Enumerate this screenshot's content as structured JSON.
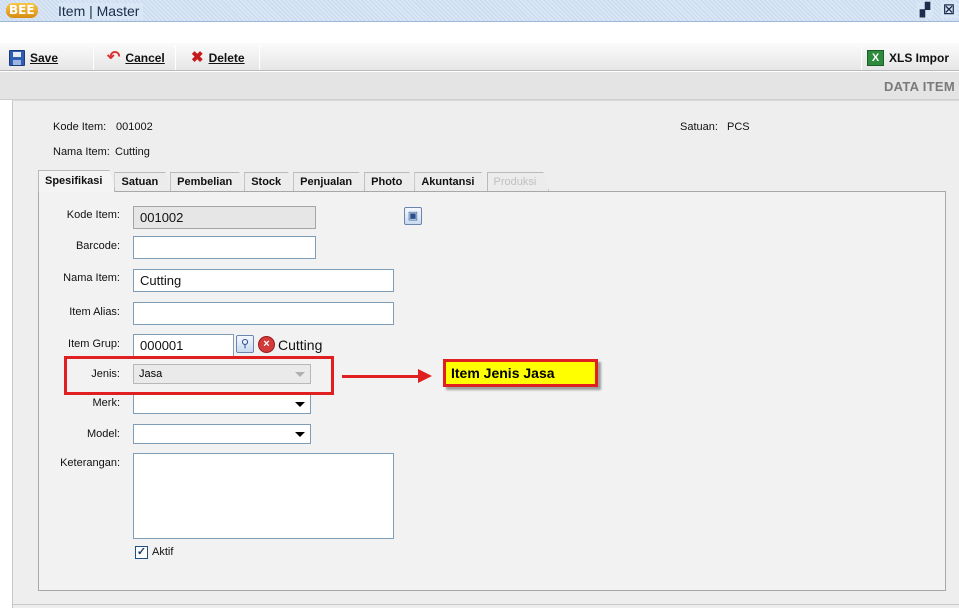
{
  "window": {
    "logo_text": "BEE",
    "title": "Item | Master",
    "restore_glyph": "▞",
    "close_glyph": "☒"
  },
  "toolbar": {
    "save_label": "Save",
    "cancel_label": "Cancel",
    "delete_label": "Delete",
    "xls_label": "XLS Impor",
    "xls_icon_text": "X"
  },
  "header": {
    "title": "DATA ITEM"
  },
  "summary": {
    "kode_label": "Kode Item:",
    "kode_value": "001002",
    "nama_label": "Nama Item:",
    "nama_value": "Cutting",
    "satuan_label": "Satuan:",
    "satuan_value": "PCS"
  },
  "tabs": [
    {
      "label": "Spesifikasi",
      "active": true
    },
    {
      "label": "Satuan"
    },
    {
      "label": "Pembelian"
    },
    {
      "label": "Stock"
    },
    {
      "label": "Penjualan"
    },
    {
      "label": "Photo"
    },
    {
      "label": "Akuntansi"
    },
    {
      "label": "Produksi",
      "disabled": true
    }
  ],
  "form": {
    "kode_label": "Kode Item:",
    "kode_value": "001002",
    "barcode_label": "Barcode:",
    "barcode_value": "",
    "nama_label": "Nama Item:",
    "nama_value": "Cutting",
    "alias_label": "Item Alias:",
    "alias_value": "",
    "grup_label": "Item Grup:",
    "grup_value": "000001",
    "grup_name": "Cutting",
    "jenis_label": "Jenis:",
    "jenis_value": "Jasa",
    "merk_label": "Merk:",
    "merk_value": "",
    "model_label": "Model:",
    "model_value": "",
    "keterangan_label": "Keterangan:",
    "aktif_label": "Aktif",
    "aktif_checked": true
  },
  "annotation": {
    "callout_text": "Item Jenis Jasa"
  },
  "colors": {
    "highlight": "#e02020",
    "callout_bg": "#ffff00"
  }
}
